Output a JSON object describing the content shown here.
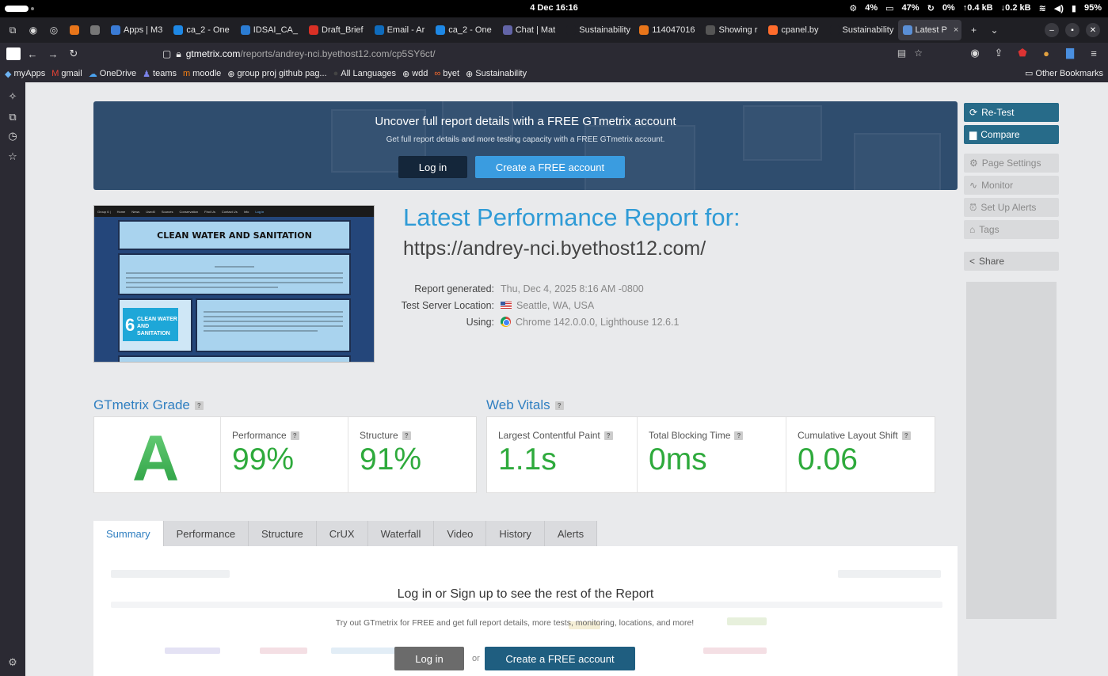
{
  "os": {
    "clock": "4 Dec 16:16",
    "status": [
      "4%",
      "47%",
      "0%",
      "↑0.4 kB",
      "↓0.2 kB",
      "95%"
    ]
  },
  "browser": {
    "tabs": [
      {
        "label": "",
        "color": "#e8751a"
      },
      {
        "label": "",
        "color": "#777777"
      },
      {
        "label": "Apps | M3",
        "color": "#3a7bd5"
      },
      {
        "label": "ca_2 - One",
        "color": "#1e88e5"
      },
      {
        "label": "IDSAI_CA_",
        "color": "#2b7cd3"
      },
      {
        "label": "Draft_Brief",
        "color": "#d93025"
      },
      {
        "label": "Email - Ar",
        "color": "#0f6cbd"
      },
      {
        "label": "ca_2 - One",
        "color": "#1e88e5"
      },
      {
        "label": "Chat | Mat",
        "color": "#6264a7"
      },
      {
        "label": "Sustainability",
        "color": "#1f1f24"
      },
      {
        "label": "114047016",
        "color": "#e8751a"
      },
      {
        "label": "Showing r",
        "color": "#555555"
      },
      {
        "label": "cpanel.by",
        "color": "#ff6c2c"
      },
      {
        "label": "Sustainability",
        "color": "#1f1f24"
      },
      {
        "label": "Latest P",
        "color": "#5a8fd6"
      }
    ],
    "url_host": "gtmetrix.com",
    "url_path": "/reports/andrey-nci.byethost12.com/cp5SY6ct/",
    "bookmarks": [
      "myApps",
      "gmail",
      "OneDrive",
      "teams",
      "moodle",
      "group proj github pag...",
      "All Languages",
      "wdd",
      "byet",
      "Sustainability"
    ],
    "other_bookmarks": "Other Bookmarks"
  },
  "banner": {
    "title": "Uncover full report details with a FREE GTmetrix account",
    "subtitle": "Get full report details and more testing capacity with a FREE GTmetrix account.",
    "login_label": "Log in",
    "create_label": "Create a FREE account"
  },
  "thumbnail": {
    "nav_items": [
      "Group 6 |",
      "Home",
      "News",
      "Used0",
      "Sources",
      "Conservation",
      "Find Us",
      "Contact Us",
      "Info",
      "Log in"
    ],
    "heading": "CLEAN WATER AND SANITATION",
    "sdg_number": "6",
    "sdg_text": "CLEAN WATER AND SANITATION"
  },
  "report": {
    "title": "Latest Performance Report for:",
    "url": "https://andrey-nci.byethost12.com/",
    "generated_label": "Report generated:",
    "generated_value": "Thu, Dec 4, 2025 8:16 AM -0800",
    "location_label": "Test Server Location:",
    "location_value": "Seattle, WA, USA",
    "using_label": "Using:",
    "using_value": "Chrome 142.0.0.0, Lighthouse 12.6.1"
  },
  "grade": {
    "heading": "GTmetrix Grade",
    "letter": "A",
    "performance_label": "Performance",
    "performance_value": "99%",
    "structure_label": "Structure",
    "structure_value": "91%"
  },
  "vitals": {
    "heading": "Web Vitals",
    "lcp_label": "Largest Contentful Paint",
    "lcp_value": "1.1s",
    "tbt_label": "Total Blocking Time",
    "tbt_value": "0ms",
    "cls_label": "Cumulative Layout Shift",
    "cls_value": "0.06"
  },
  "tabs": [
    "Summary",
    "Performance",
    "Structure",
    "CrUX",
    "Waterfall",
    "Video",
    "History",
    "Alerts"
  ],
  "gate": {
    "title": "Log in or Sign up to see the rest of the Report",
    "subtitle": "Try out GTmetrix for FREE and get full report details, more tests, monitoring, locations, and more!",
    "login_label": "Log in",
    "or": "or",
    "create_label": "Create a FREE account"
  },
  "actions": {
    "retest": "Re-Test",
    "compare": "Compare",
    "page_settings": "Page Settings",
    "monitor": "Monitor",
    "alerts": "Set Up Alerts",
    "tags": "Tags",
    "share": "Share"
  },
  "colors": {
    "accent": "#2f9bd6",
    "grade_green": "#2eaa3c",
    "banner_bg": "#2f4d6e",
    "action_bg": "#276b89"
  }
}
